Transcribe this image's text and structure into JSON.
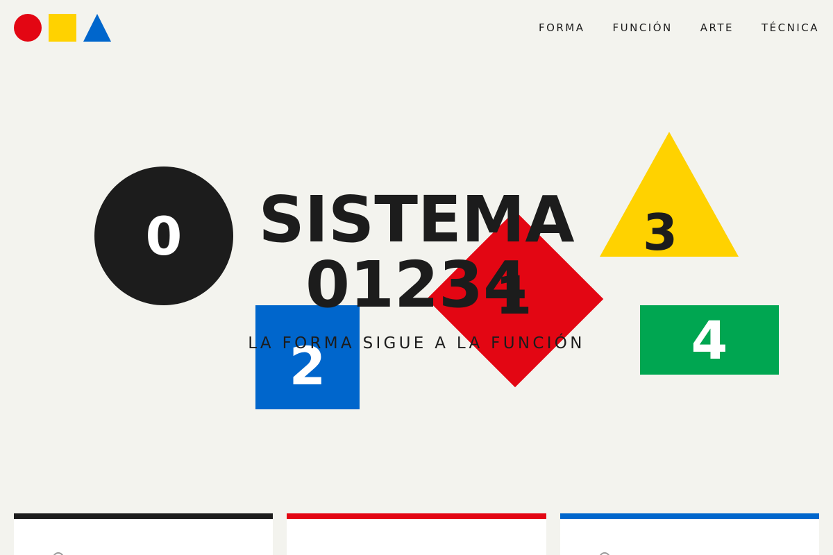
{
  "nav": {
    "items": [
      {
        "label": "FORMA"
      },
      {
        "label": "FUNCIÓN"
      },
      {
        "label": "ARTE"
      },
      {
        "label": "TÉCNICA"
      }
    ]
  },
  "logo": {
    "shapes": [
      "red-circle",
      "yellow-square",
      "blue-triangle"
    ]
  },
  "hero": {
    "title_line1": "SISTEMA",
    "title_line2": "01234",
    "subtitle": "LA FORMA SIGUE A LA FUNCIÓN",
    "shapes": [
      {
        "label": "0",
        "shape": "circle",
        "color": "#1c1c1c"
      },
      {
        "label": "1",
        "shape": "diamond",
        "color": "#e30613"
      },
      {
        "label": "2",
        "shape": "square",
        "color": "#0066cc"
      },
      {
        "label": "3",
        "shape": "triangle",
        "color": "#ffd200"
      },
      {
        "label": "4",
        "shape": "rectangle",
        "color": "#00a651"
      }
    ]
  },
  "cards": [
    {
      "accent": "#1c1c1c"
    },
    {
      "accent": "#e30613"
    },
    {
      "accent": "#0066cc"
    }
  ],
  "colors": {
    "background": "#f3f3ee",
    "text": "#1c1c1c",
    "red": "#e30613",
    "yellow": "#ffd200",
    "blue": "#0066cc",
    "green": "#00a651"
  }
}
